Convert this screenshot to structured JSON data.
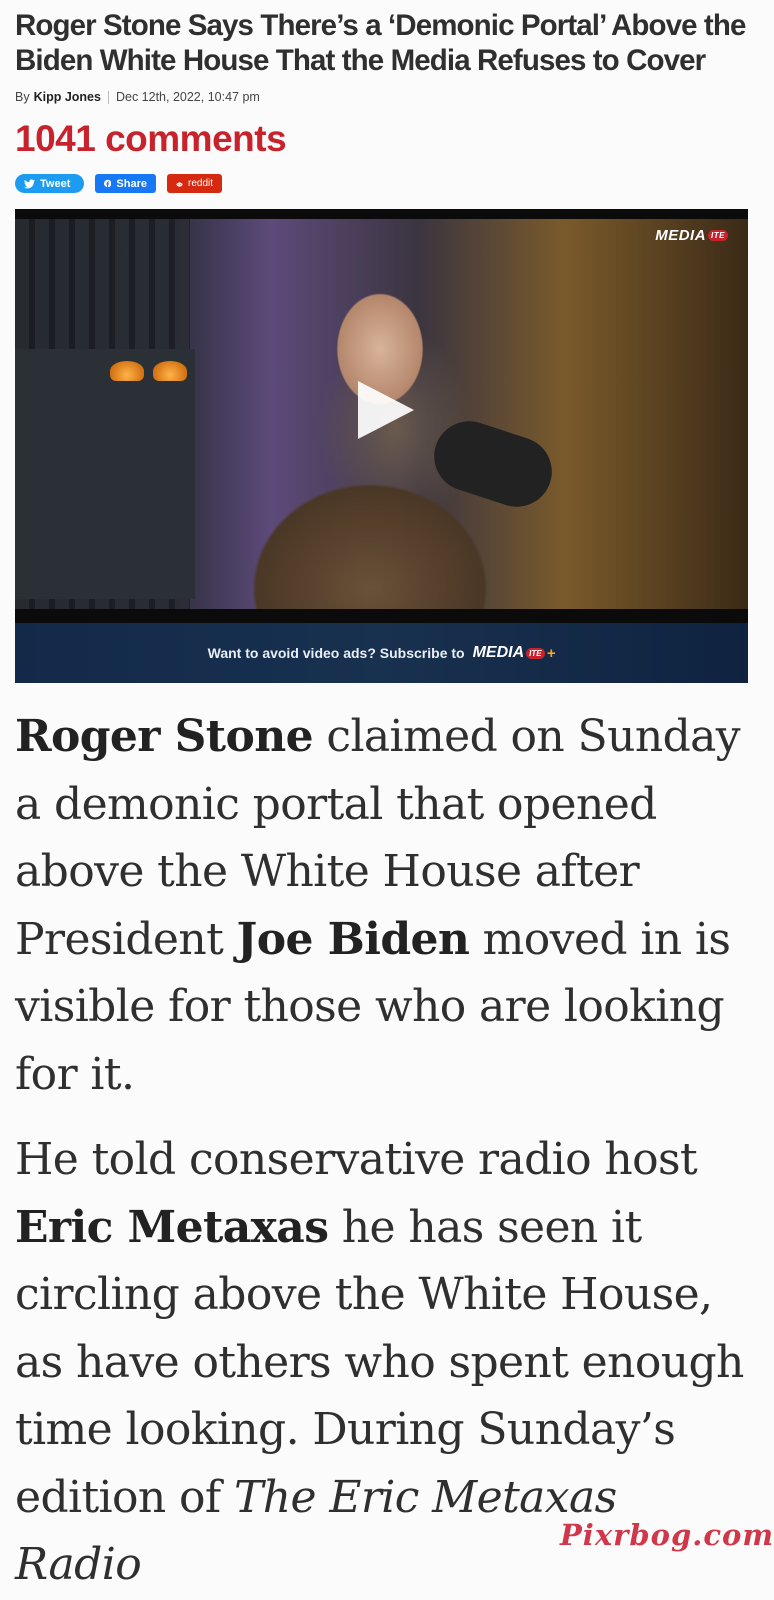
{
  "article": {
    "headline": "Roger Stone Says There’s a ‘Demonic Portal’ Above the Biden White House That the Media Refuses to Cover",
    "byline_prefix": "By",
    "author": "Kipp Jones",
    "date": "Dec 12th, 2022, 10:47 pm",
    "comments": "1041 comments",
    "share": {
      "tweet": "Tweet",
      "facebook": "Share",
      "reddit": "reddit"
    },
    "video": {
      "brand": "MEDIA",
      "brand_badge": "ITE",
      "ad_text": "Want to avoid video ads? Subscribe to",
      "ad_brand": "MEDIA",
      "ad_badge": "ITE",
      "ad_plus": "+"
    },
    "p1": {
      "b1": "Roger Stone",
      "t1": " claimed on Sunday a demonic portal that opened above the White House after President ",
      "b2": "Joe Biden",
      "t2": " moved in is visible for those who are looking for it."
    },
    "p2": {
      "t1": "He told conservative radio host ",
      "b1": "Eric Metaxas",
      "t2": " he has seen it circling above the White House, as have others who spent enough time looking. During Sunday’s edition of ",
      "i1": "The Eric Metaxas Radio"
    }
  },
  "watermark": "Pixrbog.com",
  "colors": {
    "comments": "#c8232c",
    "twitter": "#1d9bf0",
    "facebook": "#1877f2",
    "reddit": "#d52a0f",
    "ad_bar": "#13294a"
  }
}
